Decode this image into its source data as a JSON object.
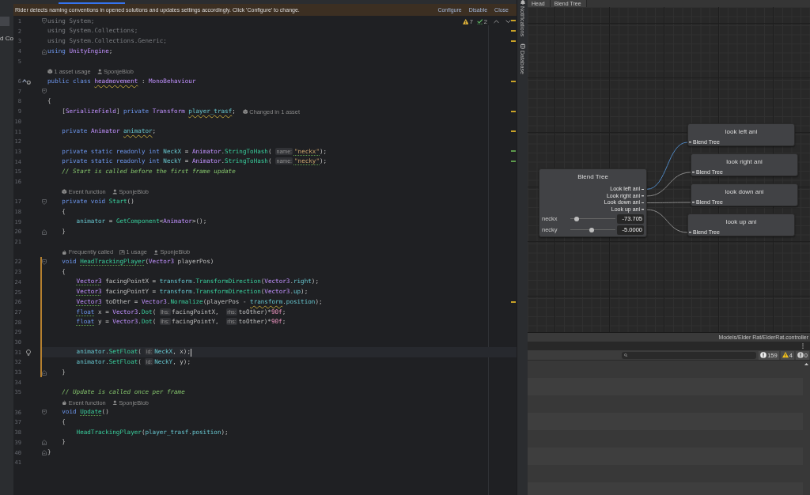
{
  "tab_strip": {
    "tabs": [
      {
        "selected": true
      }
    ]
  },
  "banner": {
    "message": "Rider detects naming conventions in opened solutions and updates settings accordingly. Click 'Configure' to change.",
    "actions": [
      "Configure",
      "Disable",
      "Close"
    ]
  },
  "side_panel": {
    "label": "d Co"
  },
  "code": {
    "inspections": {
      "warnings": "7",
      "typos": "2"
    },
    "rows": [
      {
        "kind": "code",
        "number": "1",
        "fold": {
          "kind": "start"
        },
        "stripe": {
          "kind": "warning"
        },
        "current": false,
        "changed": false,
        "tokens": [
          {
            "text": "using System;",
            "kind": "unused"
          }
        ]
      },
      {
        "kind": "code",
        "number": "2",
        "stripe": {
          "kind": "warning"
        },
        "current": false,
        "changed": false,
        "tokens": [
          {
            "text": "using System.Collections;",
            "kind": "unused"
          }
        ]
      },
      {
        "kind": "code",
        "number": "3",
        "stripe": {
          "kind": "warning"
        },
        "current": false,
        "changed": false,
        "tokens": [
          {
            "text": "using System.Collections.Generic;",
            "kind": "unused"
          }
        ]
      },
      {
        "kind": "code",
        "number": "4",
        "fold": {
          "kind": "end"
        },
        "current": false,
        "changed": false,
        "tokens": [
          {
            "text": "using ",
            "kind": "keyword"
          },
          {
            "text": "UnityEngine",
            "kind": "type"
          },
          {
            "text": ";",
            "kind": "plain"
          }
        ]
      },
      {
        "kind": "code",
        "number": "5",
        "current": false,
        "changed": false
      },
      {
        "kind": "lens",
        "items": [
          {
            "kind": "asset",
            "text": "1 asset usage"
          },
          {
            "kind": "author",
            "text": "SponjeBlob"
          }
        ]
      },
      {
        "kind": "code",
        "number": "6",
        "gutter_mark": {
          "kind": "implements"
        },
        "stripe": {
          "kind": "warning"
        },
        "current": false,
        "changed": false,
        "tokens": [
          {
            "text": "public class ",
            "kind": "keyword"
          },
          {
            "text": "headmovement",
            "kind": "type",
            "squiggle": {
              "kind": "warning"
            }
          },
          {
            "text": " : ",
            "kind": "plain"
          },
          {
            "text": "MonoBehaviour",
            "kind": "type"
          }
        ]
      },
      {
        "kind": "code",
        "number": "7",
        "fold": {
          "kind": "start"
        },
        "current": false,
        "changed": false
      },
      {
        "kind": "code",
        "number": "8",
        "current": false,
        "changed": false,
        "tokens": [
          {
            "text": "{",
            "kind": "plain"
          }
        ]
      },
      {
        "kind": "code",
        "number": "9",
        "stripe": {
          "kind": "warning"
        },
        "current": false,
        "changed": false,
        "tokens": [
          {
            "text": "    [",
            "kind": "plain"
          },
          {
            "text": "SerializeField",
            "kind": "type"
          },
          {
            "text": "] ",
            "kind": "plain"
          },
          {
            "text": "private ",
            "kind": "keyword"
          },
          {
            "text": "Transform ",
            "kind": "type"
          },
          {
            "text": "player_trasf",
            "kind": "field",
            "squiggle": {
              "kind": "warning"
            }
          },
          {
            "text": ";",
            "kind": "plain"
          }
        ],
        "lens": {
          "kind": "asset",
          "text": "Changed in 1 asset"
        }
      },
      {
        "kind": "code",
        "number": "10",
        "current": false,
        "changed": false
      },
      {
        "kind": "code",
        "number": "11",
        "stripe": {
          "kind": "warning"
        },
        "current": false,
        "changed": false,
        "tokens": [
          {
            "text": "    private ",
            "kind": "keyword"
          },
          {
            "text": "Animator ",
            "kind": "type"
          },
          {
            "text": "animator",
            "kind": "field",
            "squiggle": {
              "kind": "warning"
            }
          },
          {
            "text": ";",
            "kind": "plain"
          }
        ]
      },
      {
        "kind": "code",
        "number": "12",
        "current": false,
        "changed": false
      },
      {
        "kind": "code",
        "number": "13",
        "stripe": {
          "kind": "typo"
        },
        "current": false,
        "changed": false,
        "tokens": [
          {
            "text": "    private static readonly int ",
            "kind": "keyword"
          },
          {
            "text": "NeckX",
            "kind": "field"
          },
          {
            "text": " = ",
            "kind": "plain"
          },
          {
            "text": "Animator",
            "kind": "type"
          },
          {
            "text": ".",
            "kind": "plain"
          },
          {
            "text": "StringToHash",
            "kind": "method"
          },
          {
            "text": "(",
            "kind": "plain"
          },
          {
            "text": "name:",
            "kind": "hint"
          },
          {
            "text": "\"neckx\"",
            "kind": "string",
            "squiggle": {
              "kind": "typo"
            }
          },
          {
            "text": ");",
            "kind": "plain"
          }
        ]
      },
      {
        "kind": "code",
        "number": "14",
        "stripe": {
          "kind": "typo"
        },
        "current": false,
        "changed": false,
        "tokens": [
          {
            "text": "    private static readonly int ",
            "kind": "keyword"
          },
          {
            "text": "NeckY",
            "kind": "field"
          },
          {
            "text": " = ",
            "kind": "plain"
          },
          {
            "text": "Animator",
            "kind": "type"
          },
          {
            "text": ".",
            "kind": "plain"
          },
          {
            "text": "StringToHash",
            "kind": "method"
          },
          {
            "text": "(",
            "kind": "plain"
          },
          {
            "text": "name:",
            "kind": "hint"
          },
          {
            "text": "\"necky\"",
            "kind": "string",
            "squiggle": {
              "kind": "typo"
            }
          },
          {
            "text": ");",
            "kind": "plain"
          }
        ]
      },
      {
        "kind": "code",
        "number": "15",
        "current": false,
        "changed": false,
        "tokens": [
          {
            "text": "    // Start is called before the first frame update",
            "kind": "comment"
          }
        ]
      },
      {
        "kind": "code",
        "number": "16",
        "current": false,
        "changed": false
      },
      {
        "kind": "lens",
        "items": [
          {
            "kind": "asset",
            "text": "Event function"
          },
          {
            "kind": "author",
            "text": "SponjeBlob"
          }
        ]
      },
      {
        "kind": "code",
        "number": "17",
        "fold": {
          "kind": "start"
        },
        "current": false,
        "changed": false,
        "tokens": [
          {
            "text": "    private void ",
            "kind": "keyword"
          },
          {
            "text": "Start",
            "kind": "method"
          },
          {
            "text": "()",
            "kind": "plain"
          }
        ]
      },
      {
        "kind": "code",
        "number": "18",
        "current": false,
        "changed": false,
        "tokens": [
          {
            "text": "    {",
            "kind": "plain"
          }
        ]
      },
      {
        "kind": "code",
        "number": "19",
        "current": false,
        "changed": false,
        "tokens": [
          {
            "text": "        animator",
            "kind": "field"
          },
          {
            "text": " = ",
            "kind": "plain"
          },
          {
            "text": "GetComponent",
            "kind": "method"
          },
          {
            "text": "<",
            "kind": "plain"
          },
          {
            "text": "Animator",
            "kind": "type"
          },
          {
            "text": ">();",
            "kind": "plain"
          }
        ]
      },
      {
        "kind": "code",
        "number": "20",
        "fold": {
          "kind": "end"
        },
        "current": false,
        "changed": false,
        "tokens": [
          {
            "text": "    }",
            "kind": "plain"
          }
        ]
      },
      {
        "kind": "code",
        "number": "21",
        "current": false,
        "changed": false
      },
      {
        "kind": "lens",
        "items": [
          {
            "kind": "hot",
            "text": "Frequently called"
          },
          {
            "kind": "usages",
            "text": "1 usage"
          },
          {
            "kind": "author",
            "text": "SponjeBlob"
          }
        ]
      },
      {
        "kind": "code",
        "number": "22",
        "fold": {
          "kind": "start"
        },
        "current": false,
        "changed": true,
        "tokens": [
          {
            "text": "    void ",
            "kind": "keyword"
          },
          {
            "text": "HeadTrackingPlayer",
            "kind": "method",
            "squiggle": {
              "kind": "typo"
            }
          },
          {
            "text": "(",
            "kind": "plain"
          },
          {
            "text": "Vector3 ",
            "kind": "type"
          },
          {
            "text": "playerPos)",
            "kind": "plain"
          }
        ]
      },
      {
        "kind": "code",
        "number": "23",
        "current": false,
        "changed": true,
        "tokens": [
          {
            "text": "    {",
            "kind": "plain"
          }
        ]
      },
      {
        "kind": "code",
        "number": "24",
        "current": false,
        "changed": true,
        "tokens": [
          {
            "text": "        Vector3",
            "kind": "type",
            "squiggle": {
              "kind": "typo"
            }
          },
          {
            "text": " facingPointX = ",
            "kind": "plain"
          },
          {
            "text": "transform",
            "kind": "field"
          },
          {
            "text": ".",
            "kind": "plain"
          },
          {
            "text": "TransformDirection",
            "kind": "method"
          },
          {
            "text": "(",
            "kind": "plain"
          },
          {
            "text": "Vector3",
            "kind": "type"
          },
          {
            "text": ".",
            "kind": "plain"
          },
          {
            "text": "right",
            "kind": "field"
          },
          {
            "text": ");",
            "kind": "plain"
          }
        ]
      },
      {
        "kind": "code",
        "number": "25",
        "current": false,
        "changed": true,
        "tokens": [
          {
            "text": "        Vector3",
            "kind": "type",
            "squiggle": {
              "kind": "typo"
            }
          },
          {
            "text": " facingPointY = ",
            "kind": "plain"
          },
          {
            "text": "transform",
            "kind": "field"
          },
          {
            "text": ".",
            "kind": "plain"
          },
          {
            "text": "TransformDirection",
            "kind": "method"
          },
          {
            "text": "(",
            "kind": "plain"
          },
          {
            "text": "Vector3",
            "kind": "type"
          },
          {
            "text": ".",
            "kind": "plain"
          },
          {
            "text": "up",
            "kind": "field"
          },
          {
            "text": ");",
            "kind": "plain"
          }
        ]
      },
      {
        "kind": "code",
        "number": "26",
        "stripe": {
          "kind": "warning"
        },
        "current": false,
        "changed": true,
        "tokens": [
          {
            "text": "        Vector3",
            "kind": "type",
            "squiggle": {
              "kind": "typo"
            }
          },
          {
            "text": " toOther = ",
            "kind": "plain"
          },
          {
            "text": "Vector3",
            "kind": "type"
          },
          {
            "text": ".",
            "kind": "plain"
          },
          {
            "text": "Normalize",
            "kind": "method"
          },
          {
            "text": "(playerPos - ",
            "kind": "plain"
          },
          {
            "text": "transform",
            "kind": "field",
            "squiggle": {
              "kind": "warning"
            }
          },
          {
            "text": ".",
            "kind": "plain"
          },
          {
            "text": "position",
            "kind": "field"
          },
          {
            "text": ");",
            "kind": "plain"
          }
        ]
      },
      {
        "kind": "code",
        "number": "27",
        "current": false,
        "changed": true,
        "tokens": [
          {
            "text": "        float",
            "kind": "keyword",
            "squiggle": {
              "kind": "typo"
            }
          },
          {
            "text": " x = ",
            "kind": "plain"
          },
          {
            "text": "Vector3",
            "kind": "type"
          },
          {
            "text": ".",
            "kind": "plain"
          },
          {
            "text": "Dot",
            "kind": "method"
          },
          {
            "text": "(",
            "kind": "plain"
          },
          {
            "text": "lhs:",
            "kind": "hint"
          },
          {
            "text": "facingPointX, ",
            "kind": "plain"
          },
          {
            "text": "rhs:",
            "kind": "hint"
          },
          {
            "text": "toOther)*",
            "kind": "plain"
          },
          {
            "text": "90f",
            "kind": "number"
          },
          {
            "text": ";",
            "kind": "plain"
          }
        ]
      },
      {
        "kind": "code",
        "number": "28",
        "current": false,
        "changed": true,
        "tokens": [
          {
            "text": "        float",
            "kind": "keyword",
            "squiggle": {
              "kind": "typo"
            }
          },
          {
            "text": " y = ",
            "kind": "plain"
          },
          {
            "text": "Vector3",
            "kind": "type"
          },
          {
            "text": ".",
            "kind": "plain"
          },
          {
            "text": "Dot",
            "kind": "method"
          },
          {
            "text": "(",
            "kind": "plain"
          },
          {
            "text": "lhs:",
            "kind": "hint"
          },
          {
            "text": "facingPointY, ",
            "kind": "plain"
          },
          {
            "text": "rhs:",
            "kind": "hint"
          },
          {
            "text": "toOther)*",
            "kind": "plain"
          },
          {
            "text": "90f",
            "kind": "number"
          },
          {
            "text": ";",
            "kind": "plain"
          }
        ]
      },
      {
        "kind": "code",
        "number": "29",
        "current": false,
        "changed": true
      },
      {
        "kind": "code",
        "number": "30",
        "current": false,
        "changed": true
      },
      {
        "kind": "code",
        "number": "31",
        "gutter_mark": {
          "kind": "bulb"
        },
        "current": true,
        "changed": true,
        "tokens": [
          {
            "text": "        animator",
            "kind": "field"
          },
          {
            "text": ".",
            "kind": "plain"
          },
          {
            "text": "SetFloat",
            "kind": "method"
          },
          {
            "text": "(",
            "kind": "plain"
          },
          {
            "text": "id:",
            "kind": "hint"
          },
          {
            "text": "NeckX",
            "kind": "field"
          },
          {
            "text": ", x);",
            "kind": "plain"
          }
        ]
      },
      {
        "kind": "code",
        "number": "32",
        "current": false,
        "changed": true,
        "tokens": [
          {
            "text": "        animator",
            "kind": "field"
          },
          {
            "text": ".",
            "kind": "plain"
          },
          {
            "text": "SetFloat",
            "kind": "method"
          },
          {
            "text": "(",
            "kind": "plain"
          },
          {
            "text": "id:",
            "kind": "hint"
          },
          {
            "text": "NeckY",
            "kind": "field"
          },
          {
            "text": ", y);",
            "kind": "plain"
          }
        ]
      },
      {
        "kind": "code",
        "number": "33",
        "fold": {
          "kind": "end"
        },
        "current": false,
        "changed": true,
        "tokens": [
          {
            "text": "    }",
            "kind": "plain"
          }
        ]
      },
      {
        "kind": "code",
        "number": "34",
        "current": false,
        "changed": false
      },
      {
        "kind": "code",
        "number": "35",
        "current": false,
        "changed": false,
        "tokens": [
          {
            "text": "    // Update is called once per frame",
            "kind": "comment"
          }
        ]
      },
      {
        "kind": "lens",
        "items": [
          {
            "kind": "hot",
            "text": "Event function"
          },
          {
            "kind": "author",
            "text": "SponjeBlob"
          }
        ]
      },
      {
        "kind": "code",
        "number": "36",
        "fold": {
          "kind": "start"
        },
        "current": false,
        "changed": false,
        "tokens": [
          {
            "text": "    void ",
            "kind": "keyword"
          },
          {
            "text": "Update",
            "kind": "method",
            "squiggle": {
              "kind": "typo"
            }
          },
          {
            "text": "()",
            "kind": "plain"
          }
        ]
      },
      {
        "kind": "code",
        "number": "37",
        "current": false,
        "changed": false,
        "tokens": [
          {
            "text": "    {",
            "kind": "plain"
          }
        ]
      },
      {
        "kind": "code",
        "number": "38",
        "current": false,
        "changed": false,
        "tokens": [
          {
            "text": "        HeadTrackingPlayer",
            "kind": "method"
          },
          {
            "text": "(",
            "kind": "plain"
          },
          {
            "text": "player_trasf",
            "kind": "field"
          },
          {
            "text": ".",
            "kind": "plain"
          },
          {
            "text": "position",
            "kind": "field"
          },
          {
            "text": ");",
            "kind": "plain"
          }
        ]
      },
      {
        "kind": "code",
        "number": "39",
        "fold": {
          "kind": "end"
        },
        "current": false,
        "changed": false,
        "tokens": [
          {
            "text": "    }",
            "kind": "plain"
          }
        ]
      },
      {
        "kind": "code",
        "number": "40",
        "fold": {
          "kind": "end"
        },
        "current": false,
        "changed": false,
        "tokens": [
          {
            "text": "}",
            "kind": "plain"
          }
        ]
      },
      {
        "kind": "code",
        "number": "41",
        "current": false,
        "changed": false
      }
    ]
  },
  "tool_strip": [
    {
      "label": "Notifications",
      "kind": "notifications"
    },
    {
      "label": "Database",
      "kind": "database"
    }
  ],
  "animator": {
    "breadcrumb": [
      "Head",
      "Blend Tree"
    ],
    "blend_tree": {
      "title": "Blend Tree",
      "outputs": [
        "Look left ani",
        "Look right ani",
        "Look down ani",
        "Look up ani"
      ],
      "parameters": [
        {
          "name": "neckx",
          "level": 0.09,
          "value": "-73.705"
        },
        {
          "name": "necky",
          "level": 0.47,
          "value": "-5.0000"
        }
      ]
    },
    "motions": [
      {
        "title": "look left ani",
        "input": "Blend Tree",
        "active": true
      },
      {
        "title": "look right ani",
        "input": "Blend Tree",
        "active": false
      },
      {
        "title": "look down ani",
        "input": "Blend Tree",
        "active": false
      },
      {
        "title": "look up ani",
        "input": "Blend Tree",
        "active": false
      }
    ],
    "asset_path": "Models/Elder Rat/ElderRat.controller"
  },
  "console": {
    "counts": [
      {
        "kind": "info",
        "count": "159"
      },
      {
        "kind": "warning",
        "count": "4"
      },
      {
        "kind": "error",
        "count": "0"
      }
    ]
  }
}
